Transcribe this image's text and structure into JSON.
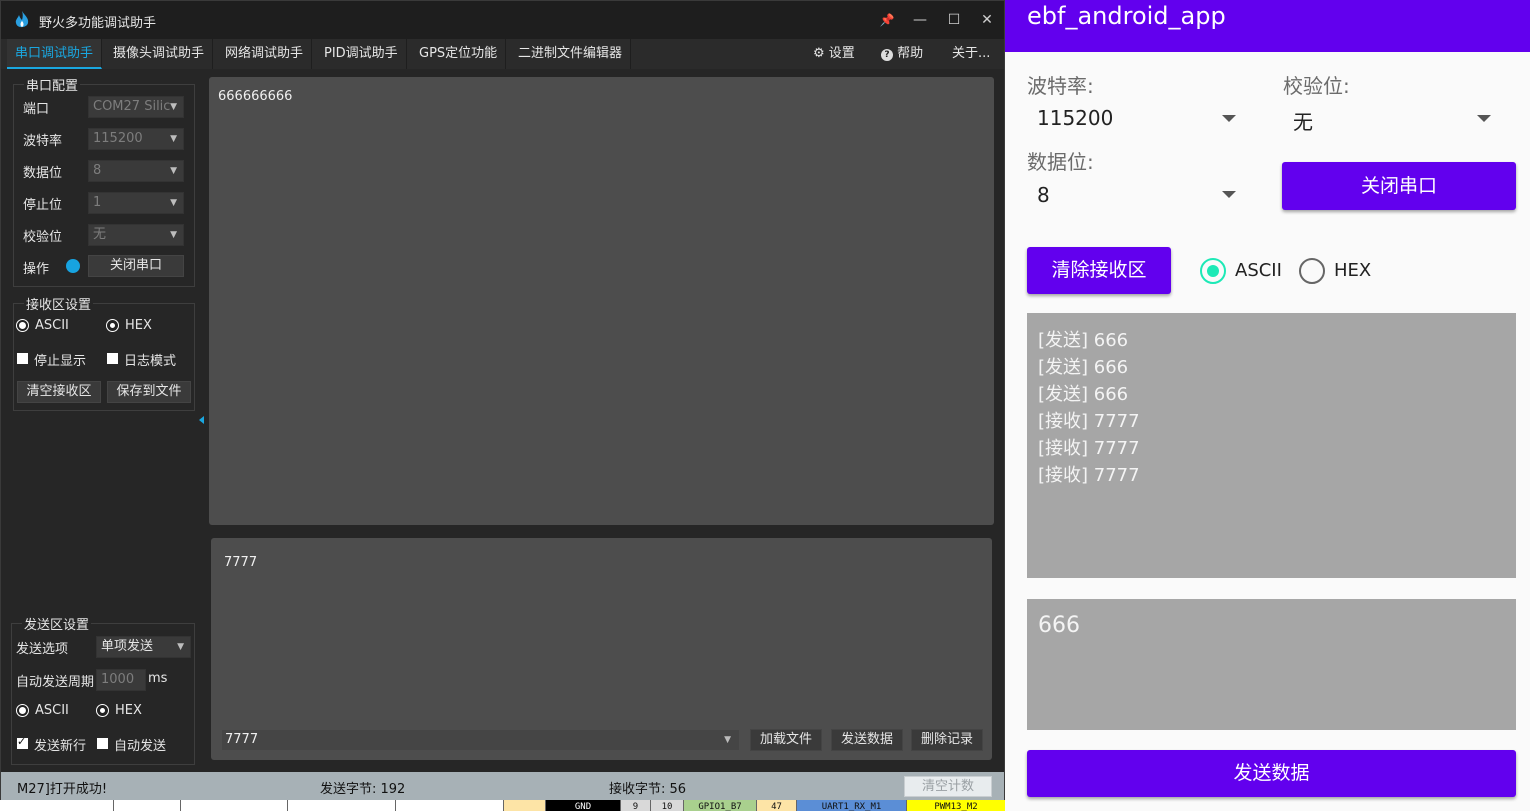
{
  "window": {
    "title": "野火多功能调试助手",
    "controls": [
      "📌",
      "—",
      "☐",
      "✕"
    ]
  },
  "tabs": [
    {
      "label": "串口调试助手",
      "active": true
    },
    {
      "label": "摄像头调试助手"
    },
    {
      "label": "网络调试助手"
    },
    {
      "label": "PID调试助手"
    },
    {
      "label": "GPS定位功能"
    },
    {
      "label": "二进制文件编辑器"
    }
  ],
  "tabs_right": {
    "settings": "设置",
    "help": "帮助",
    "about": "关于..."
  },
  "serial_config": {
    "title": "串口配置",
    "port_label": "端口",
    "port_value": "COM27 Silic",
    "baud_label": "波特率",
    "baud_value": "115200",
    "databits_label": "数据位",
    "databits_value": "8",
    "stopbits_label": "停止位",
    "stopbits_value": "1",
    "parity_label": "校验位",
    "parity_value": "无",
    "op_label": "操作",
    "close_button": "关闭串口"
  },
  "recv_settings": {
    "title": "接收区设置",
    "ascii": "ASCII",
    "hex": "HEX",
    "stop_display": "停止显示",
    "log_mode": "日志模式",
    "clear_button": "清空接收区",
    "save_button": "保存到文件"
  },
  "send_settings": {
    "title": "发送区设置",
    "option_label": "发送选项",
    "option_value": "单项发送",
    "period_label": "自动发送周期",
    "period_value": "1000",
    "period_unit": "ms",
    "ascii": "ASCII",
    "hex": "HEX",
    "newline": "发送新行",
    "auto_send": "自动发送"
  },
  "recv_area": {
    "text": "666666666"
  },
  "send_area": {
    "text": "7777",
    "combo_value": "7777",
    "load_button": "加载文件",
    "send_button": "发送数据",
    "delete_button": "删除记录"
  },
  "status": {
    "message": "M27]打开成功!",
    "sent_bytes": "发送字节: 192",
    "recv_bytes": "接收字节: 56",
    "clear_count": "清空计数"
  },
  "strip": [
    "GND",
    "9",
    "10",
    "GPIO1_B7",
    "47",
    "UART1_RX_M1",
    "PWM13_M2"
  ],
  "android": {
    "app_title": "ebf_android_app",
    "baud_label": "波特率:",
    "baud_value": "115200",
    "parity_label": "校验位:",
    "parity_value": "无",
    "databits_label": "数据位:",
    "databits_value": "8",
    "close_button": "关闭串口",
    "clear_button": "清除接收区",
    "ascii": "ASCII",
    "hex": "HEX",
    "recv_lines": [
      "[发送] 666",
      "[发送] 666",
      "[发送] 666",
      "[接收] 7777",
      "[接收] 7777",
      "[接收] 7777"
    ],
    "send_text": "666",
    "send_button": "发送数据",
    "accent": "#6200ee",
    "radio_accent": "#1de9b6"
  }
}
